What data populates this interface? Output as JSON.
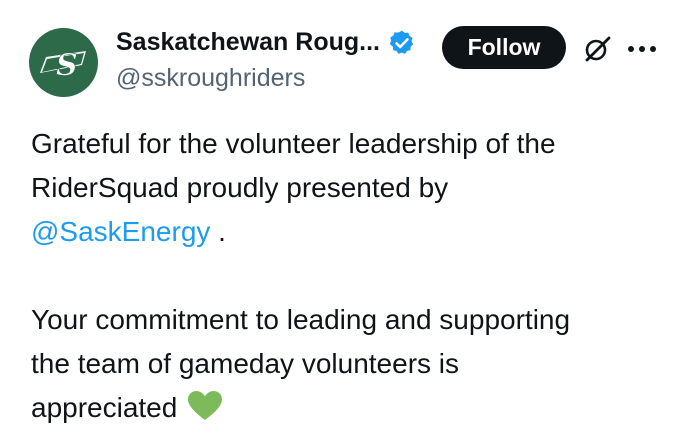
{
  "author": {
    "display_name": "Saskatchewan Roug...",
    "handle": "@sskroughriders",
    "verified": true,
    "avatar_color": "#2d6a4a",
    "avatar_icon": "roughriders-s-logo"
  },
  "actions": {
    "follow_label": "Follow",
    "grok_icon": "grok-icon",
    "more_icon": "more-options-icon"
  },
  "tweet": {
    "line1": "Grateful for the volunteer leadership of the",
    "line2": "RiderSquad proudly presented by",
    "mention": "@SaskEnergy",
    "after_mention": " .",
    "line4": "Your commitment to leading and supporting",
    "line5": "the team of gameday volunteers is",
    "line6": "appreciated",
    "emoji": "green-heart-icon"
  },
  "colors": {
    "accent": "#1d9bf0",
    "text": "#0f1419",
    "secondary": "#536471",
    "heart": "#7dbb5a"
  }
}
